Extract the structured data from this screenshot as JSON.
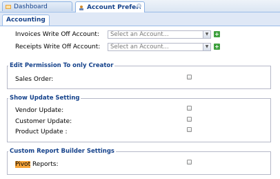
{
  "tabs": [
    {
      "label": "Dashboard",
      "icon": "dashboard-icon"
    },
    {
      "label": "Account Preferences",
      "icon": "preferences-icon"
    }
  ],
  "subtab": "Accounting",
  "accounts": {
    "invoices_label": "Invoices Write Off Account:",
    "receipts_label": "Receipts Write Off Account:",
    "placeholder": "Select an Account..."
  },
  "sections": {
    "edit_permission": {
      "title": "Edit Permission To only Creator",
      "sales_order": "Sales Order:"
    },
    "show_update": {
      "title": "Show Update Setting",
      "vendor": "Vendor Update:",
      "customer": "Customer Update:",
      "product": "Product Update :"
    },
    "custom_report": {
      "title": "Custom Report Builder Settings",
      "pivot_highlight": "Pivot",
      "pivot_rest": " Reports:"
    }
  }
}
